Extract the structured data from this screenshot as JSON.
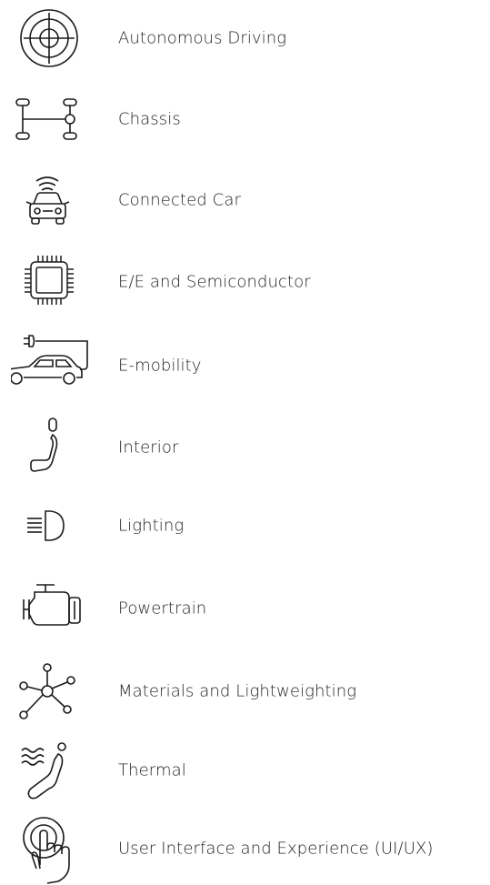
{
  "colors": {
    "text": "#222222",
    "icon_stroke": "#1a1a1a",
    "background": "#ffffff"
  },
  "topics": [
    {
      "label": "Autonomous Driving",
      "icon": "target-icon"
    },
    {
      "label": "Chassis",
      "icon": "chassis-axle-icon"
    },
    {
      "label": "Connected Car",
      "icon": "connected-car-icon"
    },
    {
      "label": "E/E and Semiconductor",
      "icon": "microchip-icon"
    },
    {
      "label": "E-mobility",
      "icon": "electric-car-plug-icon"
    },
    {
      "label": "Interior",
      "icon": "car-seat-icon"
    },
    {
      "label": "Lighting",
      "icon": "headlight-icon"
    },
    {
      "label": "Powertrain",
      "icon": "engine-icon"
    },
    {
      "label": "Materials and Lightweighting",
      "icon": "molecule-icon"
    },
    {
      "label": "Thermal",
      "icon": "thermal-seat-icon"
    },
    {
      "label": "User Interface and Experience (UI/UX)",
      "icon": "touch-hand-icon"
    }
  ]
}
